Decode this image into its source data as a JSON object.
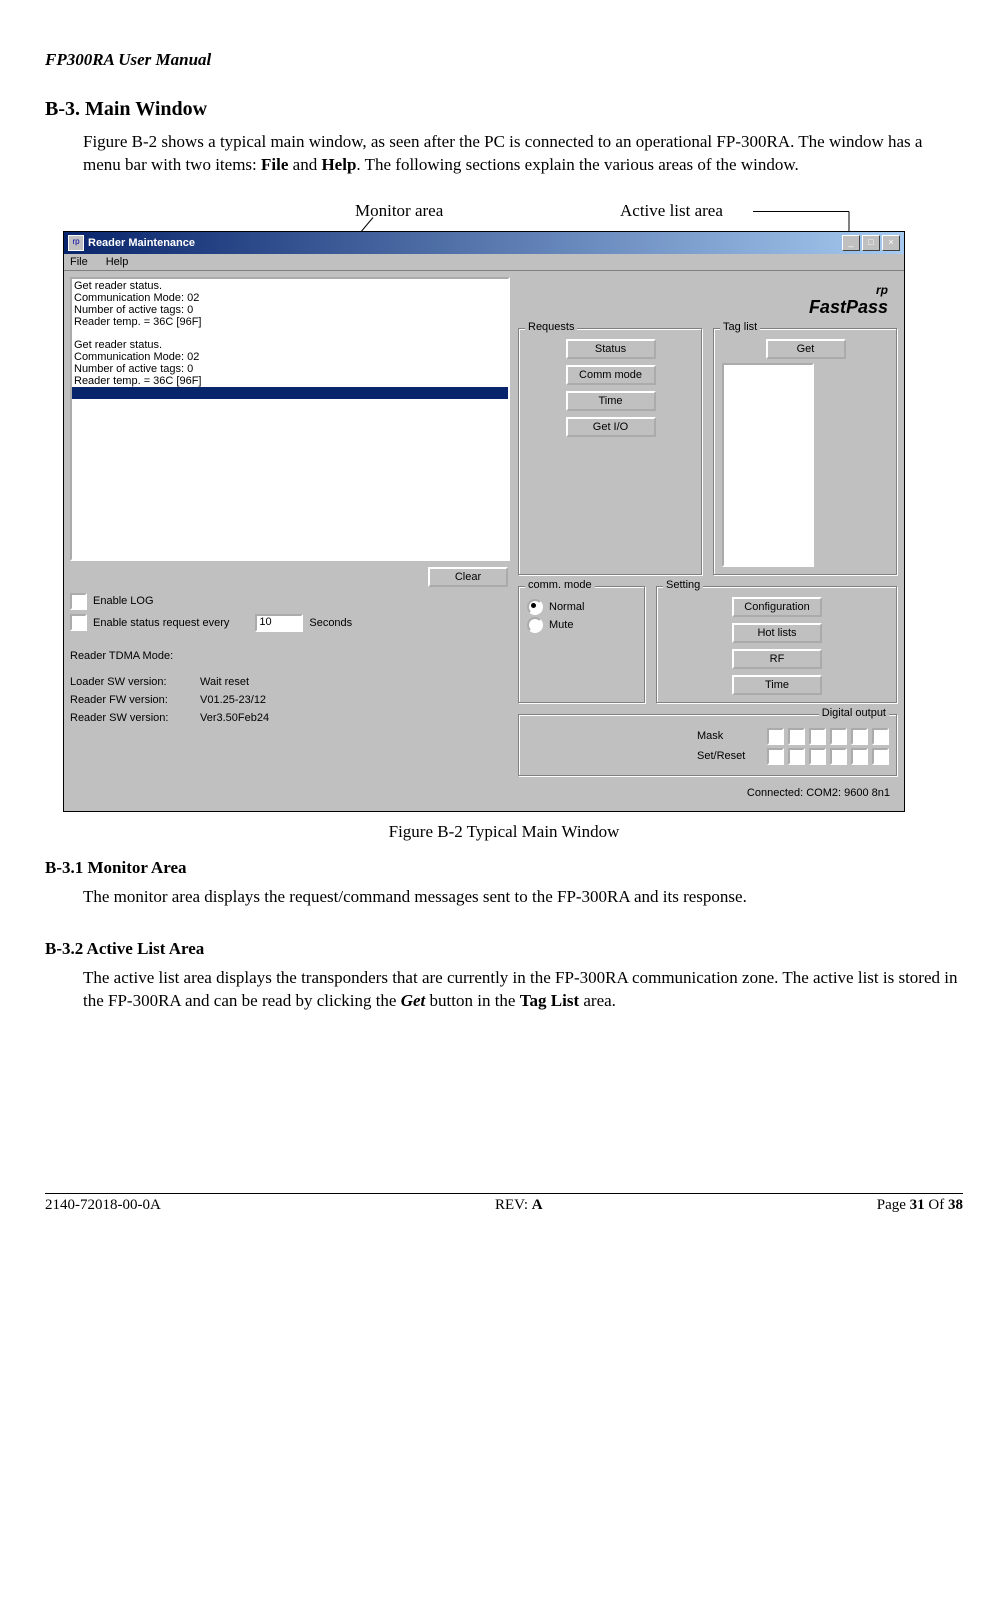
{
  "doc": {
    "header": "FP300RA User Manual",
    "h2": "B-3.   Main Window",
    "intro_a": "Figure B-2 shows a typical main window, as seen after the PC is connected to an operational FP-300RA. The window has a menu bar with two items: ",
    "intro_b": "File",
    "intro_c": " and ",
    "intro_d": "Help",
    "intro_e": ". The following sections explain the various areas of the window.",
    "label_monitor": "Monitor area",
    "label_active": "Active list area",
    "caption": "Figure B-2 Typical Main Window",
    "h3_1": "B-3.1   Monitor Area",
    "p1": "The monitor area displays the request/command messages sent to the FP-300RA and its response.",
    "h3_2": "B-3.2   Active List Area",
    "p2_a": "The active list area displays the transponders that are currently in the FP-300RA communication zone. The active list is stored in the FP-300RA and can be read by clicking the ",
    "p2_b": "Get",
    "p2_c": " button in the ",
    "p2_d": "Tag List",
    "p2_e": " area.",
    "footer_left": "2140-72018-00-0A",
    "footer_mid_a": "REV: ",
    "footer_mid_b": "A",
    "footer_right_a": "Page ",
    "footer_right_b": "31",
    "footer_right_c": " Of  ",
    "footer_right_d": "38"
  },
  "app": {
    "title": "Reader Maintenance",
    "menu_file": "File",
    "menu_help": "Help",
    "monitor_lines": {
      "l1": "Get reader status.",
      "l2": "Communication Mode: 02",
      "l3": "Number of active tags: 0",
      "l4": "Reader temp. = 36C [96F]",
      "l5": "Get reader status.",
      "l6": "Communication Mode: 02",
      "l7": "Number of active tags: 0",
      "l8": "Reader temp. = 36C [96F]"
    },
    "clear": "Clear",
    "enable_log": "Enable LOG",
    "enable_status_a": "Enable status request every",
    "enable_status_b": "Seconds",
    "status_interval": "10",
    "tdma": "Reader TDMA Mode:",
    "loader_lbl": "Loader SW version:",
    "loader_val": "Wait reset",
    "fw_lbl": "Reader FW version:",
    "fw_val": "V01.25-23/12",
    "sw_lbl": "Reader SW version:",
    "sw_val": "Ver3.50Feb24",
    "logo_top": "FastPass",
    "logo_rp": "rp",
    "requests_legend": "Requests",
    "btn_status": "Status",
    "btn_comm_mode": "Comm mode",
    "btn_time": "Time",
    "btn_getio": "Get I/O",
    "setting_legend": "Setting",
    "btn_config": "Configuration",
    "btn_hotlists": "Hot lists",
    "btn_rf": "RF",
    "btn_time2": "Time",
    "taglist_legend": "Tag list",
    "btn_get": "Get",
    "comm_mode_legend": "comm. mode",
    "radio_normal": "Normal",
    "radio_mute": "Mute",
    "digital_legend": "Digital output",
    "mask_lbl": "Mask",
    "setreset_lbl": "Set/Reset",
    "connected": "Connected: COM2: 9600 8n1"
  }
}
